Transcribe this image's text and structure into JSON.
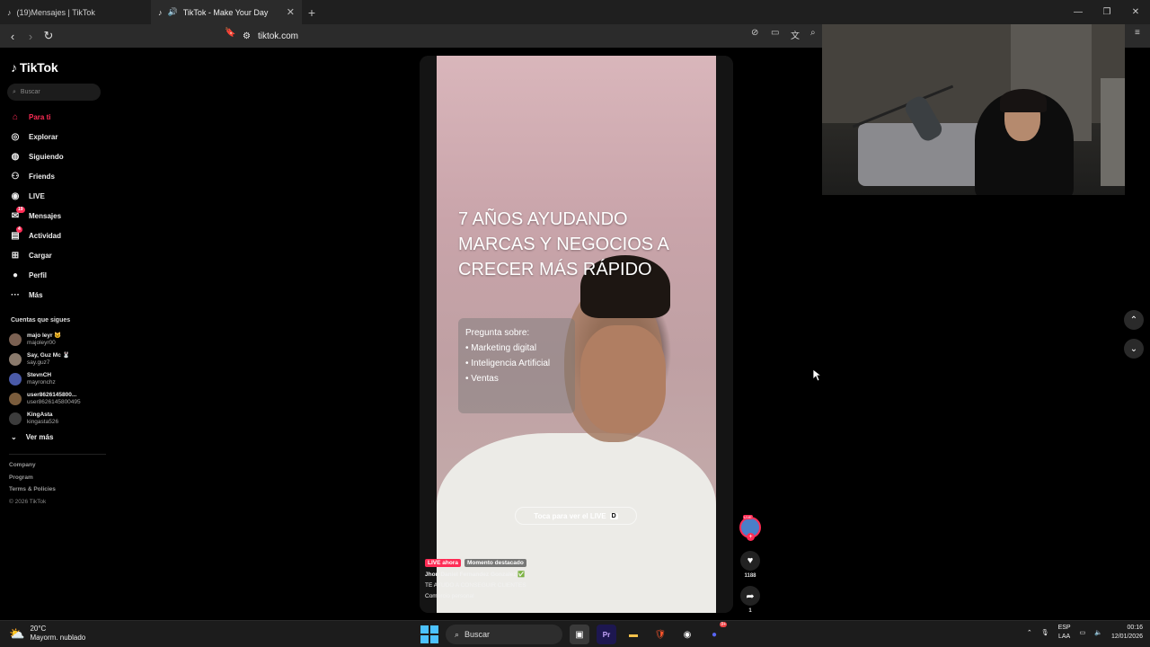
{
  "browser": {
    "tabs": [
      {
        "title": "(19)Mensajes | TikTok",
        "active": false
      },
      {
        "title": "TikTok - Make Your Day",
        "active": true
      }
    ],
    "new_tab": "+",
    "url": "tiktok.com"
  },
  "sidebar": {
    "logo": "TikTok",
    "search_placeholder": "Buscar",
    "nav": [
      {
        "label": "Para ti",
        "icon": "home-icon",
        "active": true
      },
      {
        "label": "Explorar",
        "icon": "compass-icon"
      },
      {
        "label": "Siguiendo",
        "icon": "following-icon"
      },
      {
        "label": "Friends",
        "icon": "friends-icon"
      },
      {
        "label": "LIVE",
        "icon": "live-icon"
      },
      {
        "label": "Mensajes",
        "icon": "messages-icon",
        "badge": "19"
      },
      {
        "label": "Actividad",
        "icon": "activity-icon",
        "badge": "4"
      },
      {
        "label": "Cargar",
        "icon": "upload-icon"
      },
      {
        "label": "Perfil",
        "icon": "profile-icon"
      },
      {
        "label": "Más",
        "icon": "more-icon"
      }
    ],
    "following_title": "Cuentas que sigues",
    "following": [
      {
        "name": "majo leyr 🐱",
        "handle": "majoleyr00"
      },
      {
        "name": "Say, Guz Mc 🐰",
        "handle": "say.guz7"
      },
      {
        "name": "StevnCH",
        "handle": "mayronchz"
      },
      {
        "name": "user8626145800...",
        "handle": "user8626145800495"
      },
      {
        "name": "KingAsta",
        "handle": "kingasta526"
      }
    ],
    "see_more": "Ver más",
    "footer": [
      "Company",
      "Program",
      "Terms & Policies",
      "© 2026 TikTok"
    ]
  },
  "video": {
    "headline": "7 AÑOS AYUDANDO MARCAS Y NEGOCIOS A CRECER MÁS RÁPIDO",
    "question_title": "Pregunta sobre:",
    "question_items": [
      "• Marketing digital",
      "• Inteligencia Artificial",
      "• Ventas"
    ],
    "live_pill": "Toca para ver el LIVE",
    "live_key": "D",
    "tag_live": "LIVE ahora",
    "tag_highlight": "Momento destacado",
    "caption_lines": [
      "Jhon Daniel Fernandez Gonzalez ✅",
      "TE AYUDO A CONSEGUIR CLIENTES",
      "Comercio personal"
    ],
    "likes": "1188",
    "shares": "1",
    "avatar_badge": "LIVE"
  },
  "taskbar": {
    "temp": "20°C",
    "weather": "Mayorm. nublado",
    "search": "Buscar",
    "lang": "ESP",
    "lang2": "LAA",
    "time": "00:16",
    "date": "12/01/2026",
    "discord_badge": "9+"
  },
  "colors": {
    "accent": "#fe2c55",
    "background": "#000000"
  }
}
